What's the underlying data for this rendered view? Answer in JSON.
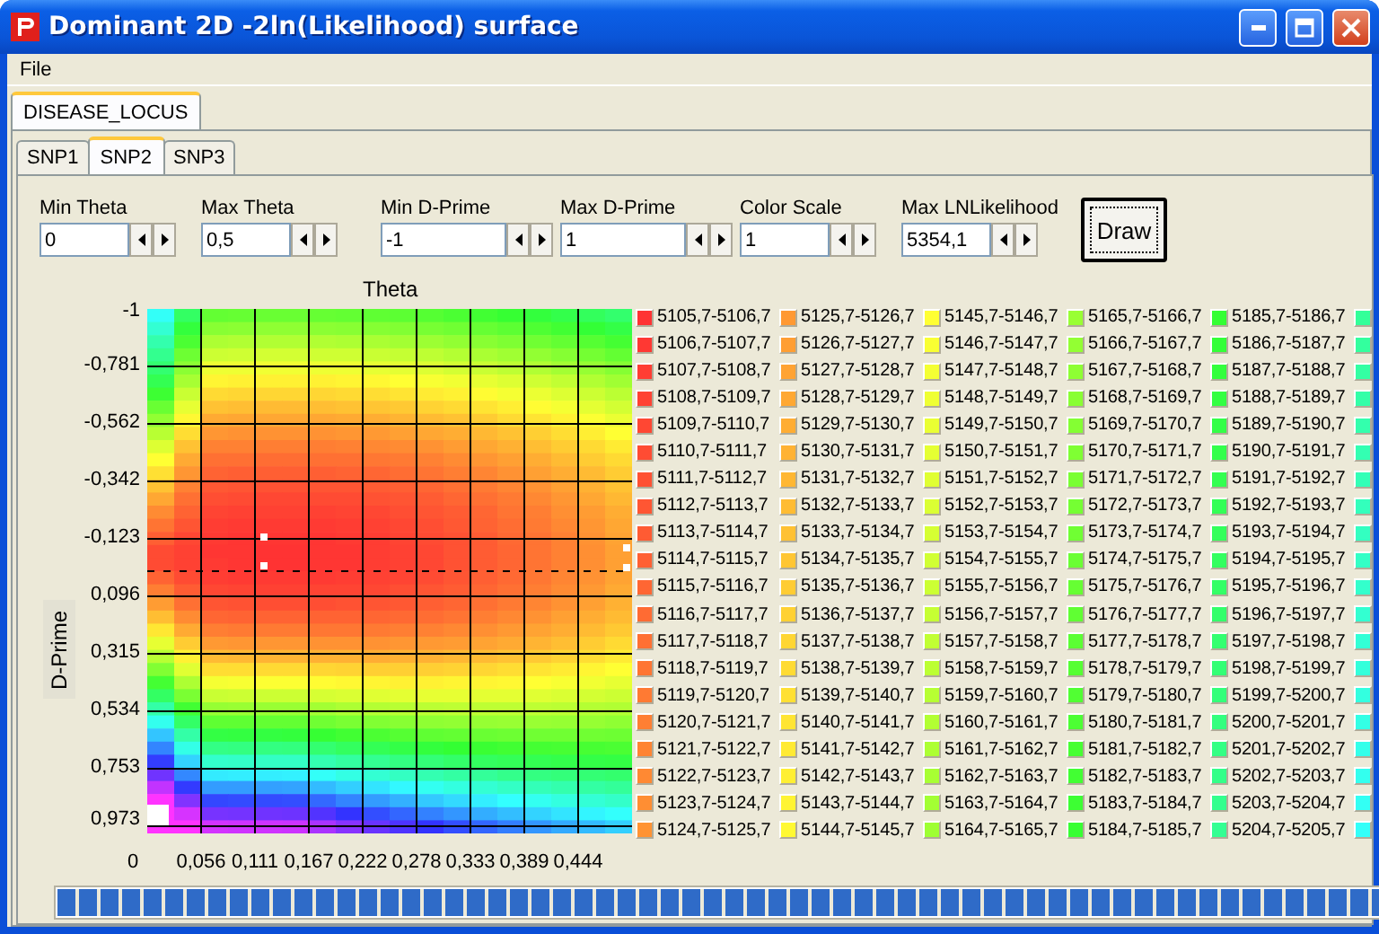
{
  "window": {
    "title": "Dominant 2D -2ln(Likelihood) surface"
  },
  "menu": [
    {
      "label": "File"
    }
  ],
  "locus_tabs": [
    {
      "label": "DISEASE_LOCUS",
      "selected": true
    }
  ],
  "snp_tabs": [
    {
      "label": "SNP1",
      "selected": false
    },
    {
      "label": "SNP2",
      "selected": true
    },
    {
      "label": "SNP3",
      "selected": false
    }
  ],
  "controls": [
    {
      "label": "Min Theta",
      "value": "0"
    },
    {
      "label": "Max Theta",
      "value": "0,5"
    },
    {
      "label": "Min D-Prime",
      "value": "-1"
    },
    {
      "label": "Max D-Prime",
      "value": "1"
    },
    {
      "label": "Color Scale",
      "value": "1"
    },
    {
      "label": "Max LNLikelihood",
      "value": "5354,1"
    }
  ],
  "draw_button": {
    "label": "Draw"
  },
  "chart": {
    "xlabel": "Theta",
    "ylabel": "D-Prime",
    "xticks": [
      "0",
      "0,056",
      "0,111",
      "0,167",
      "0,222",
      "0,278",
      "0,333",
      "0,389",
      "0,444"
    ],
    "yticks": [
      "-1",
      "-0,781",
      "-0,562",
      "-0,342",
      "-0,123",
      "0,096",
      "0,315",
      "0,534",
      "0,753",
      "0,973"
    ]
  },
  "legend": [
    {
      "label": "5105,7-5106,7",
      "color": "#ff3333"
    },
    {
      "label": "5106,7-5107,7",
      "color": "#ff3833"
    },
    {
      "label": "5107,7-5108,7",
      "color": "#ff3d33"
    },
    {
      "label": "5108,7-5109,7",
      "color": "#ff4233"
    },
    {
      "label": "5109,7-5110,7",
      "color": "#ff4733"
    },
    {
      "label": "5110,7-5111,7",
      "color": "#ff4c33"
    },
    {
      "label": "5111,7-5112,7",
      "color": "#ff5133"
    },
    {
      "label": "5112,7-5113,7",
      "color": "#ff5633"
    },
    {
      "label": "5113,7-5114,7",
      "color": "#ff5b33"
    },
    {
      "label": "5114,7-5115,7",
      "color": "#ff6033"
    },
    {
      "label": "5115,7-5116,7",
      "color": "#ff6633"
    },
    {
      "label": "5116,7-5117,7",
      "color": "#ff6b33"
    },
    {
      "label": "5117,7-5118,7",
      "color": "#ff7033"
    },
    {
      "label": "5118,7-5119,7",
      "color": "#ff7533"
    },
    {
      "label": "5119,7-5120,7",
      "color": "#ff7a33"
    },
    {
      "label": "5120,7-5121,7",
      "color": "#ff7f33"
    },
    {
      "label": "5121,7-5122,7",
      "color": "#ff8433"
    },
    {
      "label": "5122,7-5123,7",
      "color": "#ff8933"
    },
    {
      "label": "5123,7-5124,7",
      "color": "#ff8e33"
    },
    {
      "label": "5124,7-5125,7",
      "color": "#ff9333"
    },
    {
      "label": "5125,7-5126,7",
      "color": "#ff9933"
    },
    {
      "label": "5126,7-5127,7",
      "color": "#ff9e33"
    },
    {
      "label": "5127,7-5128,7",
      "color": "#ffa333"
    },
    {
      "label": "5128,7-5129,7",
      "color": "#ffa833"
    },
    {
      "label": "5129,7-5130,7",
      "color": "#ffad33"
    },
    {
      "label": "5130,7-5131,7",
      "color": "#ffb233"
    },
    {
      "label": "5131,7-5132,7",
      "color": "#ffb733"
    },
    {
      "label": "5132,7-5133,7",
      "color": "#ffbc33"
    },
    {
      "label": "5133,7-5134,7",
      "color": "#ffc133"
    },
    {
      "label": "5134,7-5135,7",
      "color": "#ffc633"
    },
    {
      "label": "5135,7-5136,7",
      "color": "#ffcc33"
    },
    {
      "label": "5136,7-5137,7",
      "color": "#ffd133"
    },
    {
      "label": "5137,7-5138,7",
      "color": "#ffd633"
    },
    {
      "label": "5138,7-5139,7",
      "color": "#ffdb33"
    },
    {
      "label": "5139,7-5140,7",
      "color": "#ffe033"
    },
    {
      "label": "5140,7-5141,7",
      "color": "#ffe533"
    },
    {
      "label": "5141,7-5142,7",
      "color": "#ffea33"
    },
    {
      "label": "5142,7-5143,7",
      "color": "#ffef33"
    },
    {
      "label": "5143,7-5144,7",
      "color": "#fff433"
    },
    {
      "label": "5144,7-5145,7",
      "color": "#fff933"
    },
    {
      "label": "5145,7-5146,7",
      "color": "#ffff33"
    },
    {
      "label": "5146,7-5147,7",
      "color": "#f9ff33"
    },
    {
      "label": "5147,7-5148,7",
      "color": "#f4ff33"
    },
    {
      "label": "5148,7-5149,7",
      "color": "#efff33"
    },
    {
      "label": "5149,7-5150,7",
      "color": "#eaff33"
    },
    {
      "label": "5150,7-5151,7",
      "color": "#e5ff33"
    },
    {
      "label": "5151,7-5152,7",
      "color": "#e0ff33"
    },
    {
      "label": "5152,7-5153,7",
      "color": "#dbff33"
    },
    {
      "label": "5153,7-5154,7",
      "color": "#d6ff33"
    },
    {
      "label": "5154,7-5155,7",
      "color": "#d1ff33"
    },
    {
      "label": "5155,7-5156,7",
      "color": "#ccff33"
    },
    {
      "label": "5156,7-5157,7",
      "color": "#c6ff33"
    },
    {
      "label": "5157,7-5158,7",
      "color": "#c1ff33"
    },
    {
      "label": "5158,7-5159,7",
      "color": "#bcff33"
    },
    {
      "label": "5159,7-5160,7",
      "color": "#b7ff33"
    },
    {
      "label": "5160,7-5161,7",
      "color": "#b2ff33"
    },
    {
      "label": "5161,7-5162,7",
      "color": "#adff33"
    },
    {
      "label": "5162,7-5163,7",
      "color": "#a8ff33"
    },
    {
      "label": "5163,7-5164,7",
      "color": "#a3ff33"
    },
    {
      "label": "5164,7-5165,7",
      "color": "#9eff33"
    },
    {
      "label": "5165,7-5166,7",
      "color": "#99ff33"
    },
    {
      "label": "5166,7-5167,7",
      "color": "#93ff33"
    },
    {
      "label": "5167,7-5168,7",
      "color": "#8eff33"
    },
    {
      "label": "5168,7-5169,7",
      "color": "#89ff33"
    },
    {
      "label": "5169,7-5170,7",
      "color": "#84ff33"
    },
    {
      "label": "5170,7-5171,7",
      "color": "#7fff33"
    },
    {
      "label": "5171,7-5172,7",
      "color": "#7aff33"
    },
    {
      "label": "5172,7-5173,7",
      "color": "#75ff33"
    },
    {
      "label": "5173,7-5174,7",
      "color": "#70ff33"
    },
    {
      "label": "5174,7-5175,7",
      "color": "#6bff33"
    },
    {
      "label": "5175,7-5176,7",
      "color": "#66ff33"
    },
    {
      "label": "5176,7-5177,7",
      "color": "#60ff33"
    },
    {
      "label": "5177,7-5178,7",
      "color": "#5bff33"
    },
    {
      "label": "5178,7-5179,7",
      "color": "#56ff33"
    },
    {
      "label": "5179,7-5180,7",
      "color": "#51ff33"
    },
    {
      "label": "5180,7-5181,7",
      "color": "#4cff33"
    },
    {
      "label": "5181,7-5182,7",
      "color": "#47ff33"
    },
    {
      "label": "5182,7-5183,7",
      "color": "#42ff33"
    },
    {
      "label": "5183,7-5184,7",
      "color": "#3dff33"
    },
    {
      "label": "5184,7-5185,7",
      "color": "#38ff33"
    },
    {
      "label": "5185,7-5186,7",
      "color": "#33ff33"
    },
    {
      "label": "5186,7-5187,7",
      "color": "#33ff38"
    },
    {
      "label": "5187,7-5188,7",
      "color": "#33ff3d"
    },
    {
      "label": "5188,7-5189,7",
      "color": "#33ff42"
    },
    {
      "label": "5189,7-5190,7",
      "color": "#33ff47"
    },
    {
      "label": "5190,7-5191,7",
      "color": "#33ff4c"
    },
    {
      "label": "5191,7-5192,7",
      "color": "#33ff51"
    },
    {
      "label": "5192,7-5193,7",
      "color": "#33ff56"
    },
    {
      "label": "5193,7-5194,7",
      "color": "#33ff5b"
    },
    {
      "label": "5194,7-5195,7",
      "color": "#33ff60"
    },
    {
      "label": "5195,7-5196,7",
      "color": "#33ff66"
    },
    {
      "label": "5196,7-5197,7",
      "color": "#33ff6b"
    },
    {
      "label": "5197,7-5198,7",
      "color": "#33ff70"
    },
    {
      "label": "5198,7-5199,7",
      "color": "#33ff75"
    },
    {
      "label": "5199,7-5200,7",
      "color": "#33ff7a"
    },
    {
      "label": "5200,7-5201,7",
      "color": "#33ff7f"
    },
    {
      "label": "5201,7-5202,7",
      "color": "#33ff84"
    },
    {
      "label": "5202,7-5203,7",
      "color": "#33ff89"
    },
    {
      "label": "5203,7-5204,7",
      "color": "#33ff8e"
    },
    {
      "label": "5204,7-5205,7",
      "color": "#33ff93"
    },
    {
      "color": "#33ff99"
    },
    {
      "color": "#33ff9e"
    },
    {
      "color": "#33ffa3"
    },
    {
      "color": "#33ffa8"
    },
    {
      "color": "#33ffad"
    },
    {
      "color": "#33ffb2"
    },
    {
      "color": "#33ffb7"
    },
    {
      "color": "#33ffbc"
    },
    {
      "color": "#33ffc1"
    },
    {
      "color": "#33ffc6"
    },
    {
      "color": "#33ffcc"
    },
    {
      "color": "#33ffd1"
    },
    {
      "color": "#33ffd6"
    },
    {
      "color": "#33ffdb"
    },
    {
      "color": "#33ffe0"
    },
    {
      "color": "#33ffe5"
    },
    {
      "color": "#33ffea"
    },
    {
      "color": "#33ffef"
    },
    {
      "color": "#33fff4"
    },
    {
      "color": "#33fff9"
    }
  ],
  "progress": {
    "level": 1
  }
}
